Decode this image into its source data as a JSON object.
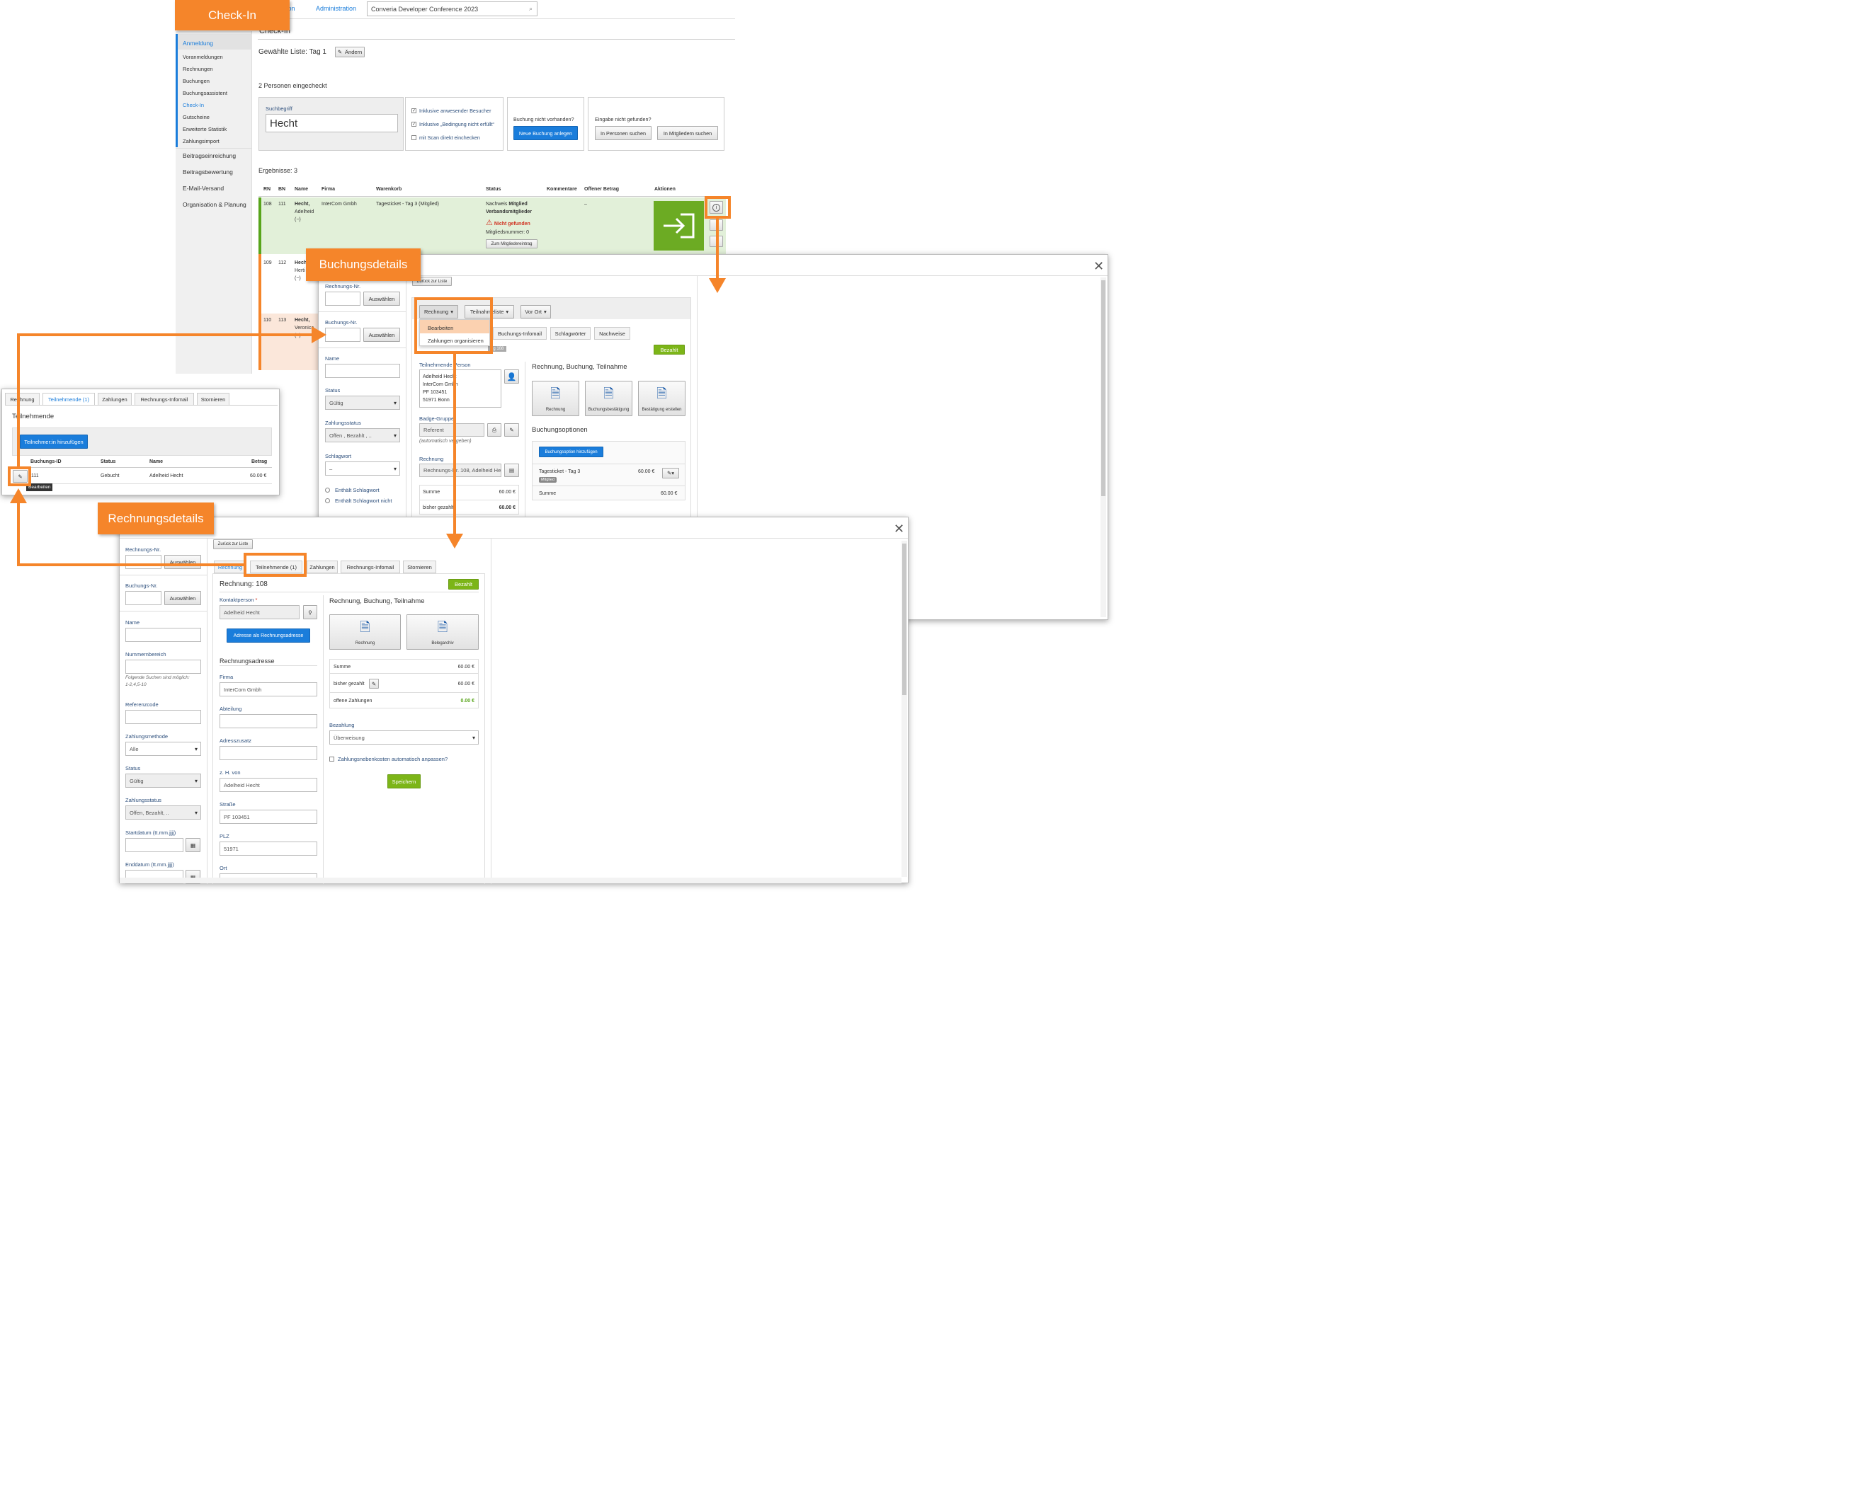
{
  "topbar": {
    "nav_a": "ration",
    "nav_b": "Administration",
    "search_value": "Converia Developer Conference 2023"
  },
  "callouts": {
    "checkin": "Check-In",
    "buchung": "Buchungsdetails",
    "rechnung": "Rechnungsdetails"
  },
  "sidebar": {
    "section": "Anmeldung",
    "items": [
      "Voranmeldungen",
      "Rechnungen",
      "Buchungen",
      "Buchungsassistent",
      "Check-In",
      "Gutscheine",
      "Erweiterte Statistik",
      "Zahlungsimport"
    ],
    "groups": [
      "Beitragseinreichung",
      "Beitragsbewertung",
      "E-Mail-Versand",
      "Organisation & Planung"
    ]
  },
  "checkin": {
    "page_title": "Check-In",
    "list_label": "Gewählte Liste: Tag 1",
    "change_btn": "Ändern",
    "checked_in": "2 Personen eingecheckt",
    "search_label": "Suchbegriff",
    "search_value": "Hecht",
    "opt1": "Inklusive anwesender Besucher",
    "opt2": "Inklusive „Bedingung nicht erfüllt“",
    "opt3": "mit Scan direkt einchecken",
    "not_found_q": "Buchung nicht vorhanden?",
    "new_booking": "Neue Buchung anlegen",
    "input_q": "Eingabe nicht gefunden?",
    "search_persons": "In Personen suchen",
    "search_members": "In Mitgliedern suchen",
    "results": "Ergebnisse: 3",
    "columns": [
      "RN",
      "BN",
      "Name",
      "Firma",
      "Warenkorb",
      "Status",
      "Kommentare",
      "Offener Betrag",
      "Aktionen"
    ],
    "rows": [
      {
        "rn": "108",
        "bn": "111",
        "name": "Hecht,",
        "first": "Adelheid",
        "extra": "(−)",
        "firma": "InterCom Gmbh",
        "cart": "Tagesticket - Tag 3 (Mitglied)",
        "status1": "Nachweis",
        "status1b": "Mitglied",
        "status2": "Verbandsmitglieder",
        "warn": "Nicht gefunden",
        "member": "Mitgliedsnummer: 0",
        "member_btn": "Zum Mitgliedereintrag",
        "open": "–"
      },
      {
        "rn": "109",
        "bn": "112",
        "name": "Hecht",
        "first": "Herti",
        "extra": "(−)"
      },
      {
        "rn": "110",
        "bn": "113",
        "name": "Hecht,",
        "first": "Veronica",
        "extra": "(−)"
      }
    ]
  },
  "buchung": {
    "back": "Zurück zur Liste",
    "rechnungsnr": "Rechnungs-Nr.",
    "buchungsnr": "Buchungs-Nr.",
    "auswaehlen": "Auswählen",
    "name": "Name",
    "status": "Status",
    "status_val": "Gültig",
    "zstatus": "Zahlungsstatus",
    "zstatus_val": "Offen , Bezahlt , ..",
    "schlagwort": "Schlagwort",
    "schlagwort_val": "–",
    "r1": "Enthält Schlagwort",
    "r2": "Enthält Schlagwort nicht",
    "dd_rechnung": "Rechnung",
    "dd_teilnahme": "Teilnahmeliste",
    "dd_vorort": "Vor Ort",
    "menu": [
      "Bearbeiten",
      "Zahlungen organisieren"
    ],
    "tabs": [
      "Buchungs-Infomail",
      "Schlagwörter",
      "Nachweise"
    ],
    "badge": "ng 108",
    "paid": "Bezahlt",
    "person_label": "Teilnehmende Person",
    "address": [
      "Adelheid Hecht",
      "InterCom Gmbh",
      "PF 103451",
      "51971 Bonn"
    ],
    "badge_group": "Badge-Gruppe",
    "badge_val": "Referent",
    "auto": "(automatisch vergeben)",
    "rechnung_label": "Rechnung",
    "rechnung_val": "Rechnungs-Nr. 108, Adelheid He",
    "sum": "Summe",
    "sum_val": "60.00 €",
    "paid_sofar": "bisher gezahlt",
    "paid_val": "60.00 €",
    "right_title": "Rechnung, Buchung, Teilnahme",
    "docs": [
      "Rechnung",
      "Buchungsbestätigung",
      "Bestätigung erstellen"
    ],
    "options": "Buchungsoptionen",
    "add_option": "Buchungsoption hinzufügen",
    "ticket": "Tagesticket - Tag 3",
    "ticket_tag": "Mitglied",
    "ticket_val": "60.00 €",
    "summe": "Summe",
    "summe_val": "60.00 €"
  },
  "teilnehmende": {
    "tabs": [
      "Rechnung",
      "Teilnehmende (1)",
      "Zahlungen",
      "Rechnungs-Infomail",
      "Stornieren"
    ],
    "title": "Teilnehmende",
    "add": "Teilnehmer:in hinzufügen",
    "cols": [
      "Buchungs-ID",
      "Status",
      "Name",
      "Betrag"
    ],
    "row": {
      "id": "111",
      "status": "Gebucht",
      "name": "Adelheid Hecht",
      "amount": "60.00 €"
    },
    "tooltip": "Bearbeiten"
  },
  "rechnung": {
    "back": "Zurück zur Liste",
    "rechnungsnr": "Rechnungs-Nr.",
    "buchungsnr": "Buchungs-Nr.",
    "auswaehlen": "Auswählen",
    "name": "Name",
    "nummernbereich": "Nummernbereich",
    "hint": "Folgende Suchen sind möglich:",
    "hint2": "1-2,4,5-10",
    "referenzcode": "Referenzcode",
    "zmethode": "Zahlungsmethode",
    "zmethode_val": "Alle",
    "status": "Status",
    "status_val": "Gültig",
    "zstatus": "Zahlungsstatus",
    "zstatus_val": "Offen, Bezahlt, ..",
    "start": "Startdatum (tt.mm.jjjj)",
    "end": "Enddatum (tt.mm.jjjj)",
    "tabs": [
      "Rechnung",
      "Teilnehmende (1)",
      "Zahlungen",
      "Rechnungs-Infomail",
      "Stornieren"
    ],
    "title": "Rechnung: 108",
    "paid": "Bezahlt",
    "kontakt": "Kontaktperson",
    "kontakt_val": "Adelheid Hecht",
    "addr_btn": "Adresse als Rechnungsadresse",
    "raddr": "Rechnungsadresse",
    "firma": "Firma",
    "firma_val": "InterCom Gmbh",
    "abteilung": "Abteilung",
    "zusatz": "Adresszusatz",
    "zhvon": "z. H. von",
    "zhvon_val": "Adelheid Hecht",
    "strasse": "Straße",
    "strasse_val": "PF 103451",
    "plz": "PLZ",
    "plz_val": "51971",
    "ort": "Ort",
    "right_title": "Rechnung, Buchung, Teilnahme",
    "docs": [
      "Rechnung",
      "Belegarchiv"
    ],
    "summe": "Summe",
    "summe_val": "60.00 €",
    "bisher": "bisher gezahlt",
    "bisher_val": "60.00 €",
    "offen": "offene Zahlungen",
    "offen_val": "0.00 €",
    "bezahlung": "Bezahlung",
    "bezahlung_val": "Überweisung",
    "nebenkosten": "Zahlungsnebenkosten automatisch anpassen?",
    "save": "Speichern"
  }
}
